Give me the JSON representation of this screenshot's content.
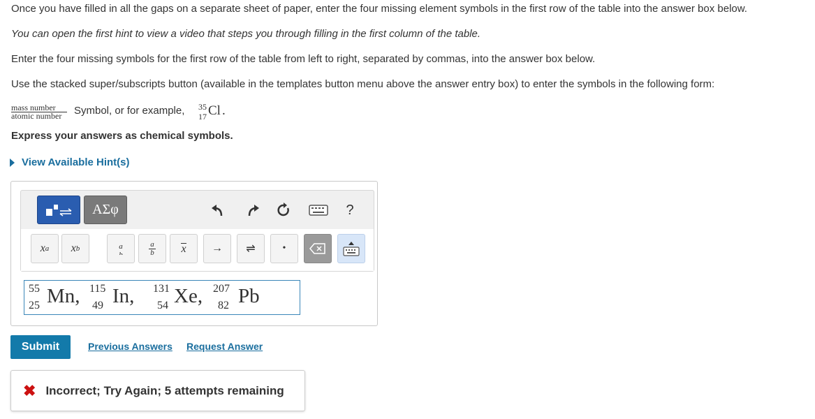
{
  "instructions": {
    "line1": "Once you have filled in all the gaps on a separate sheet of paper, enter the four missing element symbols in the first row of the table into the answer box below.",
    "line2": "You can open the first hint to view a video that steps you through filling in the first column of the table.",
    "line3": "Enter the four missing symbols for the first row of the table from left to right, separated by commas, into the answer box below.",
    "line4": "Use the stacked super/subscripts button (available in the templates button menu above the answer entry box) to enter the symbols in the following form:",
    "form_mass_label": "mass number",
    "form_atomic_label": "atomic number",
    "form_symbol_text": "Symbol, or for example,",
    "example": {
      "mass": "35",
      "atomic": "17",
      "symbol": "Cl",
      "end": "."
    },
    "express": "Express your answers as chemical symbols."
  },
  "hint": {
    "label": "View Available Hint(s)"
  },
  "editor": {
    "greek_label": "ΑΣφ",
    "help_label": "?",
    "templates": {
      "superscript_base": "x",
      "superscript_exp": "a",
      "subscript_base": "x",
      "subscript_sub": "b",
      "stack_top": "a",
      "stack_bottom": "b",
      "frac_num": "a",
      "frac_den": "b",
      "mean": "x",
      "arrow": "→",
      "equilibrium": "⇌",
      "dot": "•"
    },
    "icons": [
      "template-icon",
      "undo-icon",
      "redo-icon",
      "reset-icon",
      "keyboard-icon",
      "delete-icon",
      "keyboard-toggle-icon"
    ]
  },
  "answer": [
    {
      "mass": "55",
      "atomic": "25",
      "symbol": "Mn",
      "sep": ","
    },
    {
      "mass": "115",
      "atomic": "49",
      "symbol": "In",
      "sep": ","
    },
    {
      "mass": "131",
      "atomic": "54",
      "symbol": "Xe",
      "sep": ","
    },
    {
      "mass": "207",
      "atomic": "82",
      "symbol": "Pb",
      "sep": ""
    }
  ],
  "actions": {
    "submit": "Submit",
    "previous": "Previous Answers",
    "request": "Request Answer"
  },
  "feedback": {
    "message": "Incorrect; Try Again; 5 attempts remaining",
    "status_color": "#cc1111"
  }
}
